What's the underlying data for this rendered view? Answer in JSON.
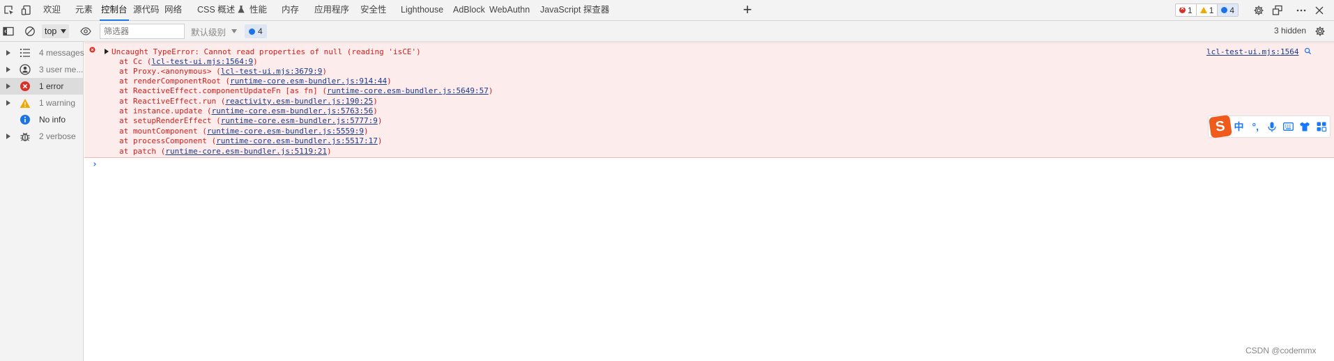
{
  "tabs": [
    {
      "label": "欢迎"
    },
    {
      "label": "元素"
    },
    {
      "label": "控制台"
    },
    {
      "label": "源代码"
    },
    {
      "label": "网络"
    },
    {
      "label": "CSS 概述"
    },
    {
      "label": "性能"
    },
    {
      "label": "内存"
    },
    {
      "label": "应用程序"
    },
    {
      "label": "安全性"
    },
    {
      "label": "Lighthouse"
    },
    {
      "label": "AdBlock"
    },
    {
      "label": "WebAuthn"
    },
    {
      "label": "JavaScript 探查器"
    }
  ],
  "active_tab": "控制台",
  "counts": {
    "errors": "1",
    "warnings": "1",
    "messages": "4"
  },
  "toolbar": {
    "context": "top",
    "filter_placeholder": "筛选器",
    "levels": "默认级别",
    "issues": "4",
    "hidden": "3 hidden"
  },
  "sidebar": [
    {
      "label": "4 messages",
      "icon": "list-icon"
    },
    {
      "label": "3 user me...",
      "icon": "user-icon"
    },
    {
      "label": "1 error",
      "icon": "error-icon"
    },
    {
      "label": "1 warning",
      "icon": "warning-icon"
    },
    {
      "label": "No info",
      "icon": "info-icon"
    },
    {
      "label": "2 verbose",
      "icon": "bug-icon"
    }
  ],
  "error": {
    "message": "Uncaught TypeError: Cannot read properties of null (reading 'isCE')",
    "source": "lcl-test-ui.mjs:1564",
    "frames": [
      {
        "fn": "at Cc",
        "loc": "lcl-test-ui.mjs:1564:9"
      },
      {
        "fn": "at Proxy.<anonymous>",
        "loc": "lcl-test-ui.mjs:3679:9"
      },
      {
        "fn": "at renderComponentRoot",
        "loc": "runtime-core.esm-bundler.js:914:44"
      },
      {
        "fn": "at ReactiveEffect.componentUpdateFn [as fn]",
        "loc": "runtime-core.esm-bundler.js:5649:57"
      },
      {
        "fn": "at ReactiveEffect.run",
        "loc": "reactivity.esm-bundler.js:190:25"
      },
      {
        "fn": "at instance.update",
        "loc": "runtime-core.esm-bundler.js:5763:56"
      },
      {
        "fn": "at setupRenderEffect",
        "loc": "runtime-core.esm-bundler.js:5777:9"
      },
      {
        "fn": "at mountComponent",
        "loc": "runtime-core.esm-bundler.js:5559:9"
      },
      {
        "fn": "at processComponent",
        "loc": "runtime-core.esm-bundler.js:5517:17"
      },
      {
        "fn": "at patch",
        "loc": "runtime-core.esm-bundler.js:5119:21"
      }
    ]
  },
  "ime": {
    "items": [
      "中",
      "°,"
    ]
  },
  "watermark": "CSDN @codemmx",
  "colors": {
    "accent": "#1a73e8",
    "error_text": "#d3201e",
    "error_bg": "#fdecec",
    "link": "#1a3a8c",
    "ime_brand": "#f05a1b"
  }
}
